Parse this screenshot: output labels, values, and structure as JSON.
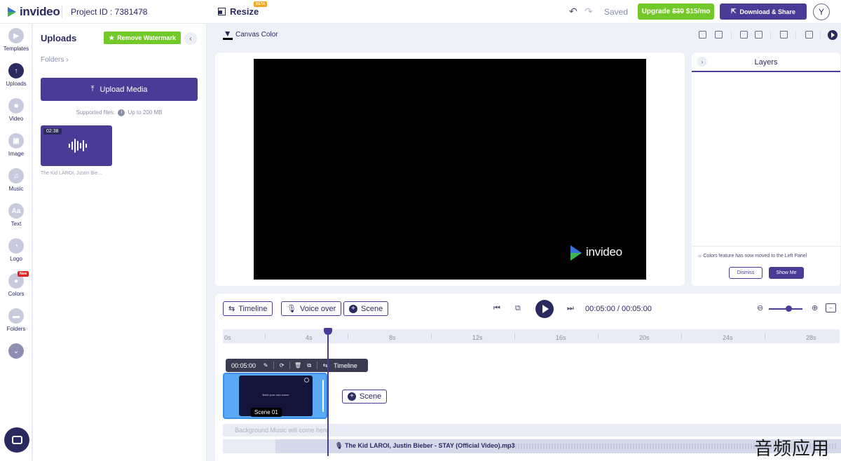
{
  "header": {
    "brand": "invideo",
    "project_id": "Project ID : 7381478",
    "resize_label": "Resize",
    "beta_badge": "BETA",
    "saved_status": "Saved",
    "upgrade": {
      "prefix": "Upgrade",
      "old_price": "$30",
      "new_price": "$15/mo"
    },
    "download_label": "Download & Share",
    "avatar_initial": "Y"
  },
  "rail": {
    "items": [
      {
        "label": "Templates",
        "icon": "templates-icon"
      },
      {
        "label": "Uploads",
        "icon": "upload-icon",
        "active": true
      },
      {
        "label": "Video",
        "icon": "video-icon"
      },
      {
        "label": "Image",
        "icon": "image-icon"
      },
      {
        "label": "Music",
        "icon": "music-icon"
      },
      {
        "label": "Text",
        "icon": "text-icon",
        "glyph": "Aa"
      },
      {
        "label": "Logo",
        "icon": "logo-icon"
      },
      {
        "label": "Colors",
        "icon": "colors-icon",
        "badge": "New"
      },
      {
        "label": "Folders",
        "icon": "folders-icon"
      }
    ]
  },
  "uploads": {
    "title": "Uploads",
    "remove_watermark": "Remove Watermark",
    "folders_link": "Folders ›",
    "upload_button": "Upload Media",
    "supported_prefix": "Supported files:",
    "supported_limit": "Up to 200 MB",
    "media": {
      "duration": "02:38",
      "name": "The Kid LAROI, Justin Bie..."
    }
  },
  "canvas": {
    "color_label": "Canvas Color",
    "watermark": "invideo"
  },
  "layers": {
    "title": "Layers",
    "notice": "Colors feature has now moved to the Left Panel",
    "dismiss": "Dismiss",
    "show_me": "Show Me"
  },
  "timeline": {
    "timeline_btn": "Timeline",
    "voiceover_btn": "Voice over",
    "scene_btn": "Scene",
    "timecode": "00:05:00 / 00:05:00",
    "ruler": [
      "0s",
      "4s",
      "8s",
      "12s",
      "16s",
      "20s",
      "24s",
      "28s"
    ],
    "scene_toolbar_time": "00:05:00",
    "scene_toolbar_timeline": "Timeline",
    "scene_label": "Scene 01",
    "scene_preview_text": "Build your own scene",
    "add_scene": "Scene",
    "bg_music_placeholder": "Background Music will come here",
    "audio_track": "The Kid LAROI, Justin Bieber - STAY (Official Video).mp3"
  },
  "watermark_overlay": "音频应用",
  "colors": {
    "accent": "#4a3c96",
    "green": "#74c92a",
    "navy": "#2b2a5e"
  }
}
